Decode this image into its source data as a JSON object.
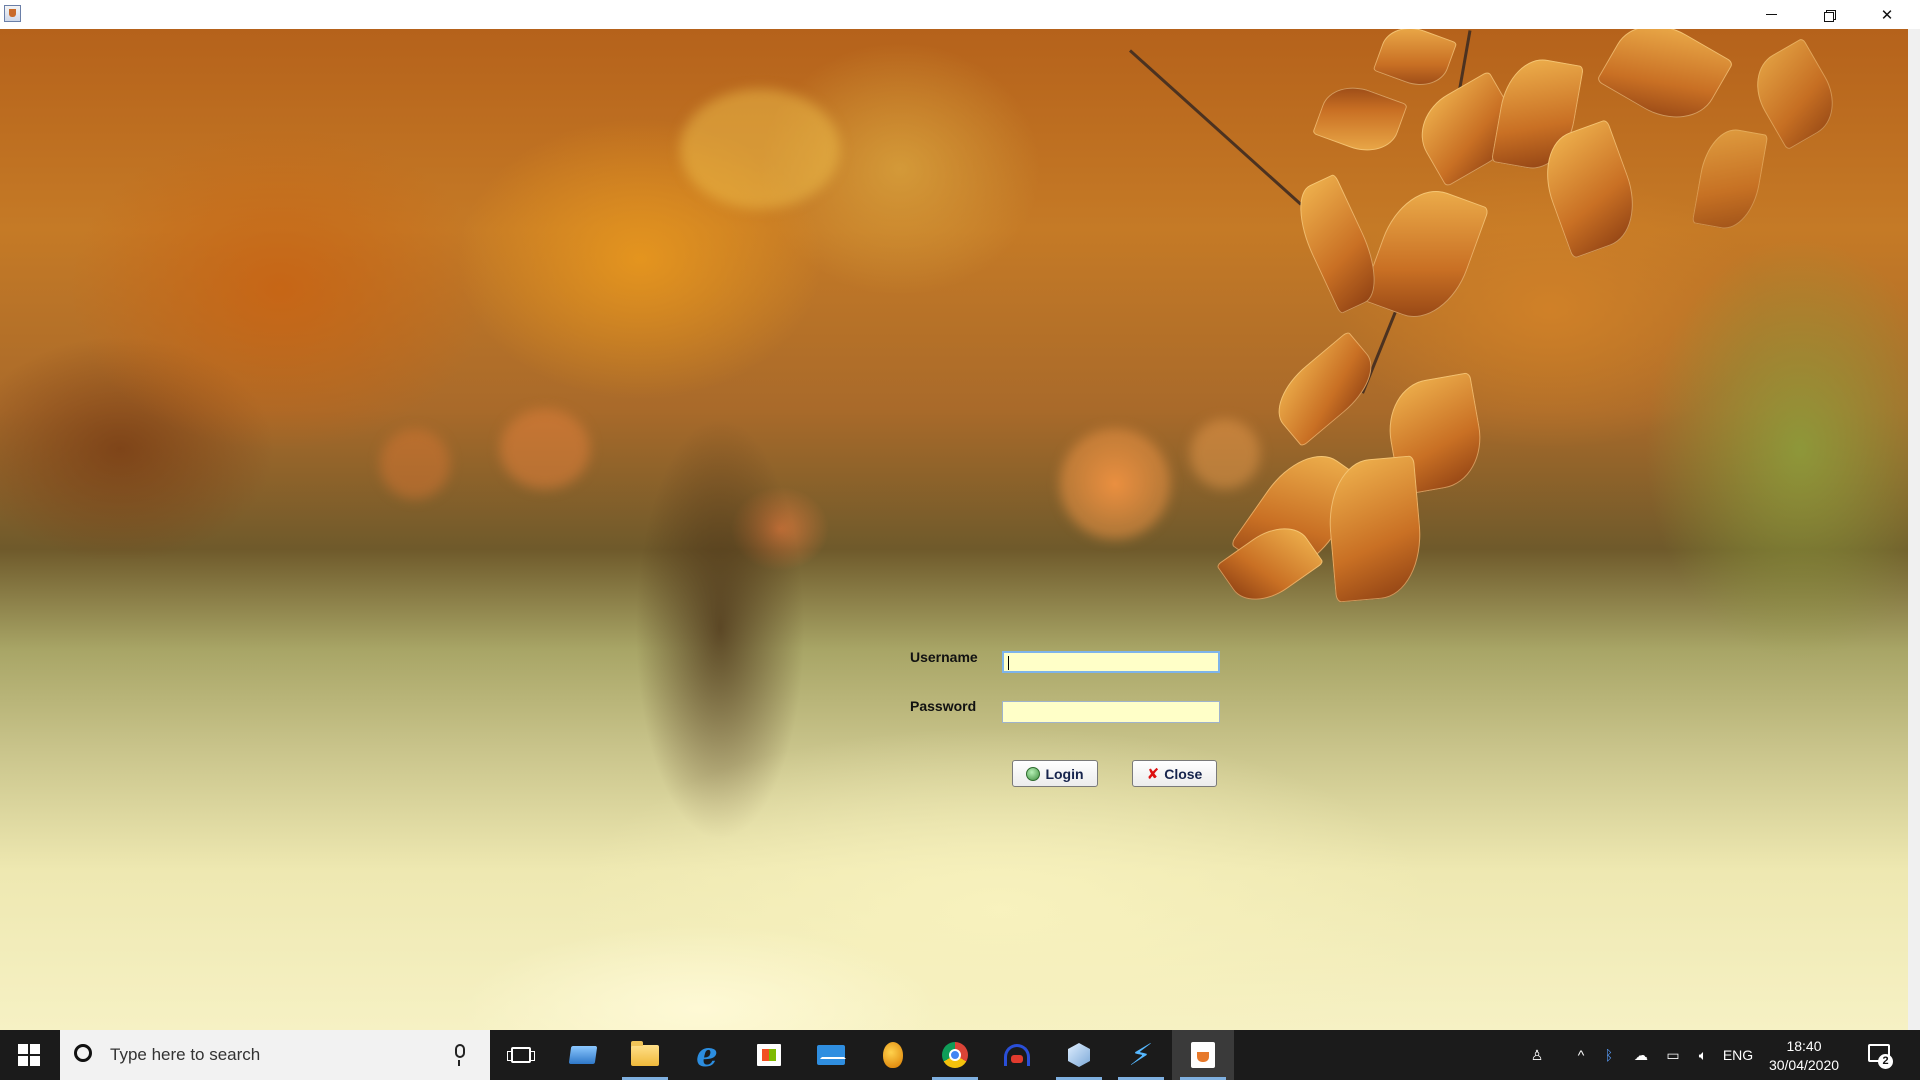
{
  "window": {
    "minimize": "—",
    "close": "✕"
  },
  "login": {
    "username_label": "Username",
    "password_label": "Password",
    "username_value": "",
    "password_value": "",
    "login_button": "Login",
    "close_button": "Close"
  },
  "taskbar": {
    "search_placeholder": "Type here to search",
    "pinned": [
      "task-view",
      "this-pc",
      "file-explorer",
      "edge",
      "microsoft-store",
      "mail",
      "fruity-app",
      "chrome",
      "headset-app",
      "virtualbox",
      "bolt-app",
      "java-app"
    ],
    "active_app": "java-app",
    "tray": {
      "language": "ENG",
      "time": "18:40",
      "date": "30/04/2020",
      "notifications": "2"
    }
  }
}
